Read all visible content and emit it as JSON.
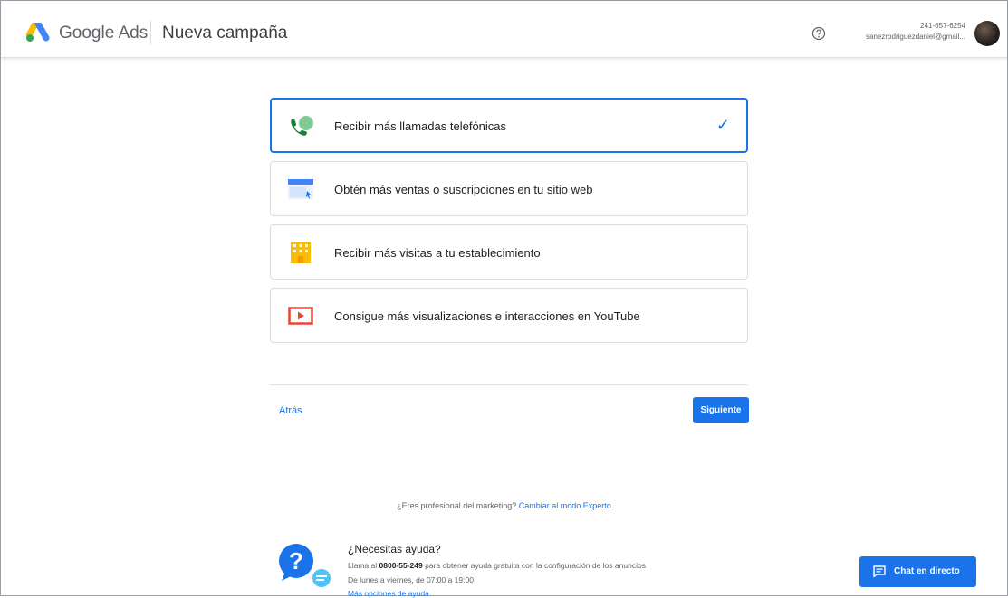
{
  "header": {
    "brand": "Google Ads",
    "page_title": "Nueva campaña",
    "account_phone": "241-657-6254",
    "account_email": "sanezrodriguezdaniel@gmail..."
  },
  "goals": [
    {
      "label": "Recibir más llamadas telefónicas",
      "icon": "phone-call-icon",
      "selected": true
    },
    {
      "label": "Obtén más ventas o suscripciones en tu sitio web",
      "icon": "website-icon",
      "selected": false
    },
    {
      "label": "Recibir más visitas a tu establecimiento",
      "icon": "store-icon",
      "selected": false
    },
    {
      "label": "Consigue más visualizaciones e interacciones en YouTube",
      "icon": "youtube-icon",
      "selected": false
    }
  ],
  "nav": {
    "back_label": "Atrás",
    "next_label": "Siguiente"
  },
  "expert": {
    "prefix": "¿Eres profesional del marketing?",
    "link": "Cambiar al modo Experto"
  },
  "help": {
    "title": "¿Necesitas ayuda?",
    "line1_prefix": "Llama al",
    "phone": "0800-55-249",
    "line1_suffix": "para obtener ayuda gratuita con la configuración de los anuncios",
    "hours": "De lunes a viernes, de 07:00 a 19:00",
    "more_link": "Más opciones de ayuda"
  },
  "chat": {
    "label": "Chat en directo"
  },
  "colors": {
    "accent": "#1a73e8",
    "google_blue": "#4285f4",
    "google_yellow": "#fbbc04",
    "google_green": "#34a853",
    "youtube_red": "#ea4335"
  }
}
